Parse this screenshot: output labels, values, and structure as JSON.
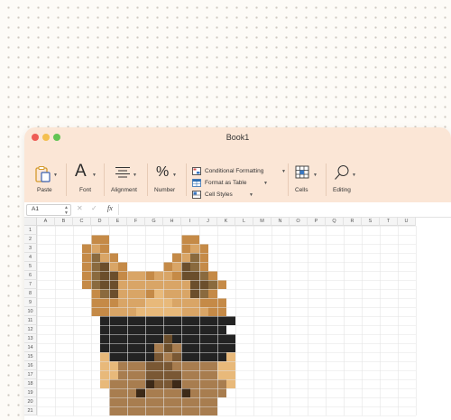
{
  "window": {
    "title": "Book1"
  },
  "ribbon": {
    "paste_label": "Paste",
    "font_label": "Font",
    "font_glyph": "A",
    "alignment_label": "Alignment",
    "number_label": "Number",
    "number_glyph": "%",
    "conditional_formatting_label": "Conditional Formatting",
    "format_as_table_label": "Format as Table",
    "cell_styles_label": "Cell Styles",
    "cells_label": "Cells",
    "editing_label": "Editing"
  },
  "formula_bar": {
    "name_box_value": "A1",
    "cancel_glyph": "✕",
    "enter_glyph": "✓",
    "fx_label": "fx",
    "formula_value": ""
  },
  "sheet": {
    "columns": [
      "A",
      "B",
      "C",
      "D",
      "E",
      "F",
      "G",
      "H",
      "I",
      "J",
      "K",
      "L",
      "M",
      "N",
      "O",
      "P",
      "Q",
      "R",
      "S",
      "T",
      "U"
    ],
    "rows": [
      "1",
      "2",
      "3",
      "4",
      "5",
      "6",
      "7",
      "8",
      "9",
      "10",
      "11",
      "12",
      "13",
      "14",
      "15",
      "16",
      "17",
      "18",
      "19",
      "20",
      "21"
    ],
    "palette": {
      "a": "#d9a566",
      "b": "#c58a47",
      "c": "#8a6a3e",
      "d": "#6b4e2c",
      "g": "#232323",
      "w": "#ffffff",
      "l": "#e8b97a",
      "m": "#a87d4f",
      "n": "#3d2a18",
      "e": "#7a5834"
    },
    "pixel_art": [
      ".........................",
      "......bb........bb......",
      ".....bab........bab.....",
      ".....bcab......bacb.....",
      ".....bcdab....badcb.....",
      ".....bcddbaabaabddcb....",
      ".....bcddaaaaaaaaddcb...",
      "......bcdaaablaaadcb....",
      "......bbbaaalllaaabbb...",
      "......bbaaalllllaaabb...",
      ".......ggggggggggggggg..",
      "......wggggggggggggggw..",
      ".......gggggggdggggggg..",
      ".......ggggggmdmgggggg..",
      ".......lgggggemegggggl..",
      ".......llmmmeeemmmmmll..",
      ".......llmmmeeeemmmmll..",
      ".......lmmmmneenmmmmml..",
      "........mmmnmmmmnmmmm...",
      "........mmmmmmmmmmmm....",
      "........mmmmmmmmmmmm...."
    ]
  }
}
